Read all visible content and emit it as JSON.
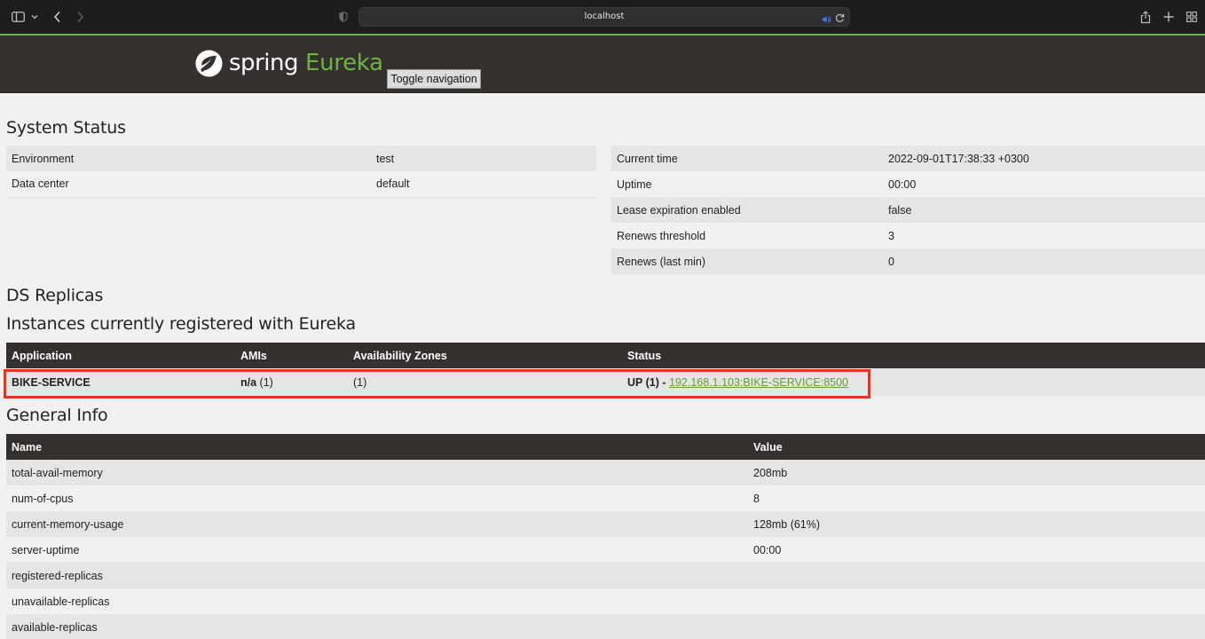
{
  "browser": {
    "url": "localhost"
  },
  "navbar": {
    "logo_text": "spring",
    "logo_product": "Eureka",
    "toggle_label": "Toggle navigation"
  },
  "system_status": {
    "heading": "System Status",
    "left": [
      {
        "label": "Environment",
        "value": "test"
      },
      {
        "label": "Data center",
        "value": "default"
      }
    ],
    "right": [
      {
        "label": "Current time",
        "value": "2022-09-01T17:38:33 +0300"
      },
      {
        "label": "Uptime",
        "value": "00:00"
      },
      {
        "label": "Lease expiration enabled",
        "value": "false"
      },
      {
        "label": "Renews threshold",
        "value": "3"
      },
      {
        "label": "Renews (last min)",
        "value": "0"
      }
    ]
  },
  "ds_replicas": {
    "heading": "DS Replicas"
  },
  "instances": {
    "heading": "Instances currently registered with Eureka",
    "columns": [
      "Application",
      "AMIs",
      "Availability Zones",
      "Status"
    ],
    "rows": [
      {
        "application": "BIKE-SERVICE",
        "amis_bold": "n/a",
        "amis_count": " (1)",
        "zones": "(1)",
        "status_prefix": "UP (1) -",
        "status_link": "192.168.1.103:BIKE-SERVICE:8500"
      }
    ]
  },
  "general_info": {
    "heading": "General Info",
    "columns": [
      "Name",
      "Value"
    ],
    "rows": [
      {
        "name": "total-avail-memory",
        "value": "208mb"
      },
      {
        "name": "num-of-cpus",
        "value": "8"
      },
      {
        "name": "current-memory-usage",
        "value": "128mb (61%)"
      },
      {
        "name": "server-uptime",
        "value": "00:00"
      },
      {
        "name": "registered-replicas",
        "value": ""
      },
      {
        "name": "unavailable-replicas",
        "value": ""
      },
      {
        "name": "available-replicas",
        "value": ""
      }
    ]
  },
  "colors": {
    "brand_green": "#6db33f",
    "navbar_bg": "#34302d",
    "highlight_red": "#e8341c"
  }
}
